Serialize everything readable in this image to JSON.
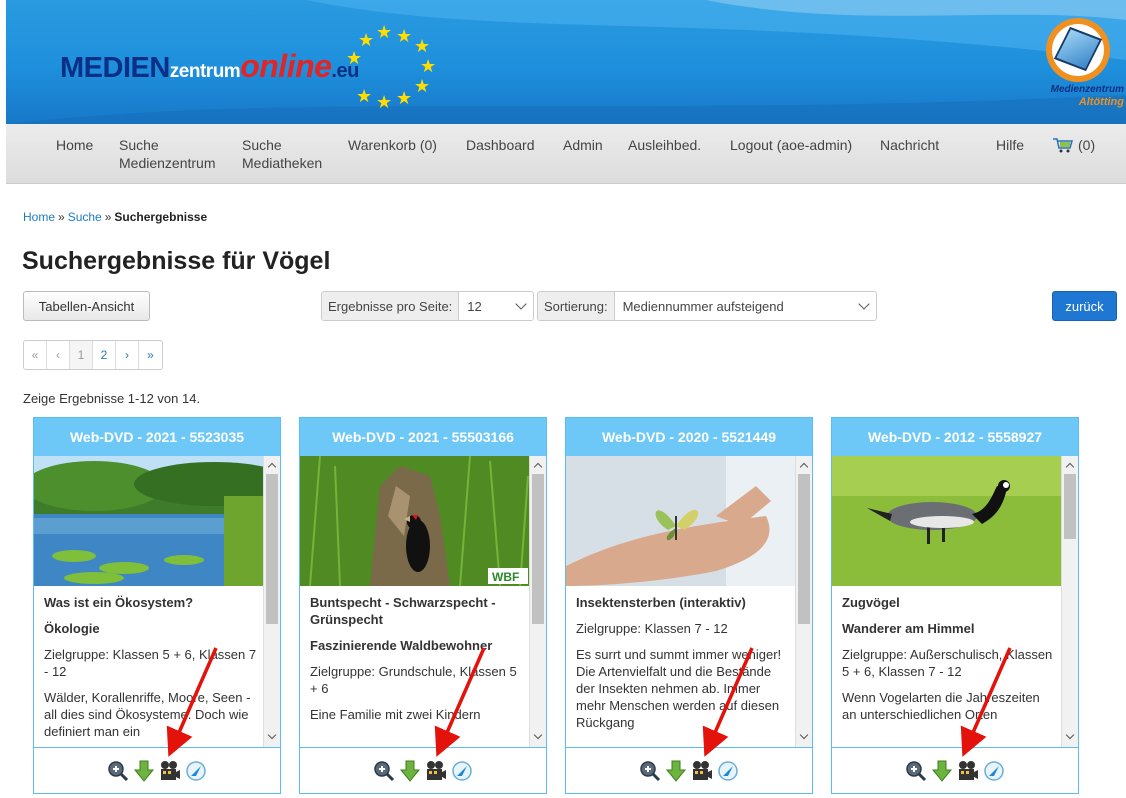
{
  "header": {
    "logo_part1": "MEDIEN",
    "logo_part2": "zentrum",
    "logo_part3": "online",
    "logo_part4": ".eu",
    "brand_line1": "Medienzentrum",
    "brand_line2": "Altötting"
  },
  "nav": {
    "items": [
      {
        "label": "Home"
      },
      {
        "label": "Suche\nMedienzentrum"
      },
      {
        "label": "Suche\nMediatheken"
      },
      {
        "label": "Warenkorb (0)"
      },
      {
        "label": "Dashboard"
      },
      {
        "label": "Admin"
      },
      {
        "label": "Ausleihbed."
      },
      {
        "label": "Logout (aoe-admin)"
      },
      {
        "label": "Nachricht"
      },
      {
        "label": "Hilfe"
      }
    ],
    "cart_count": "(0)"
  },
  "breadcrumb": {
    "home": "Home",
    "search": "Suche",
    "current": "Suchergebnisse",
    "sep": "»"
  },
  "title": "Suchergebnisse für Vögel",
  "toolbar": {
    "table_view": "Tabellen-Ansicht",
    "per_page_label": "Ergebnisse pro Seite:",
    "per_page_value": "12",
    "sort_label": "Sortierung:",
    "sort_value": "Mediennummer aufsteigend",
    "back": "zurück"
  },
  "pager": [
    "«",
    "‹",
    "1",
    "2",
    "›",
    "»"
  ],
  "result_count": "Zeige Ergebnisse 1-12 von 14.",
  "colors": {
    "accent": "#6ec8f7",
    "link": "#1e7cc2",
    "button_blue": "#1e77d2"
  },
  "cards": [
    {
      "header": "Web-DVD - 2021 - 5523035",
      "title": "Was ist ein Ökosystem?",
      "subtitle": "Ökologie",
      "target": "Zielgruppe: Klassen 5 + 6, Klassen 7 - 12",
      "desc": "Wälder, Korallenriffe, Moore, Seen - all dies sind Ökosysteme. Doch wie definiert man ein",
      "image": "lake-landscape"
    },
    {
      "header": "Web-DVD - 2021 - 55503166",
      "title": "Buntspecht - Schwarzspecht - Grünspecht",
      "subtitle": "Faszinierende Waldbewohner",
      "target": "Zielgruppe: Grundschule, Klassen 5 + 6",
      "desc": "Eine Familie mit zwei Kindern",
      "image": "woodpecker",
      "badge": "WBF"
    },
    {
      "header": "Web-DVD - 2020 - 5521449",
      "title": "Insektensterben (interaktiv)",
      "subtitle": "",
      "target": "Zielgruppe: Klassen 7 - 12",
      "desc": "Es surrt und summt immer weniger! Die Artenvielfalt und die Bestände der Insekten nehmen ab. Immer mehr Menschen werden auf diesen Rückgang",
      "image": "butterfly-hand"
    },
    {
      "header": "Web-DVD - 2012 - 5558927",
      "title": "Zugvögel",
      "subtitle": "Wanderer am Himmel",
      "target": "Zielgruppe: Außerschulisch, Klassen 5 + 6, Klassen 7 - 12",
      "desc": "Wenn Vogelarten die Jahreszeiten an unterschiedlichen Orten",
      "image": "goose"
    }
  ],
  "card_icons": [
    "zoom-icon",
    "download-icon",
    "film-icon",
    "play-icon"
  ]
}
